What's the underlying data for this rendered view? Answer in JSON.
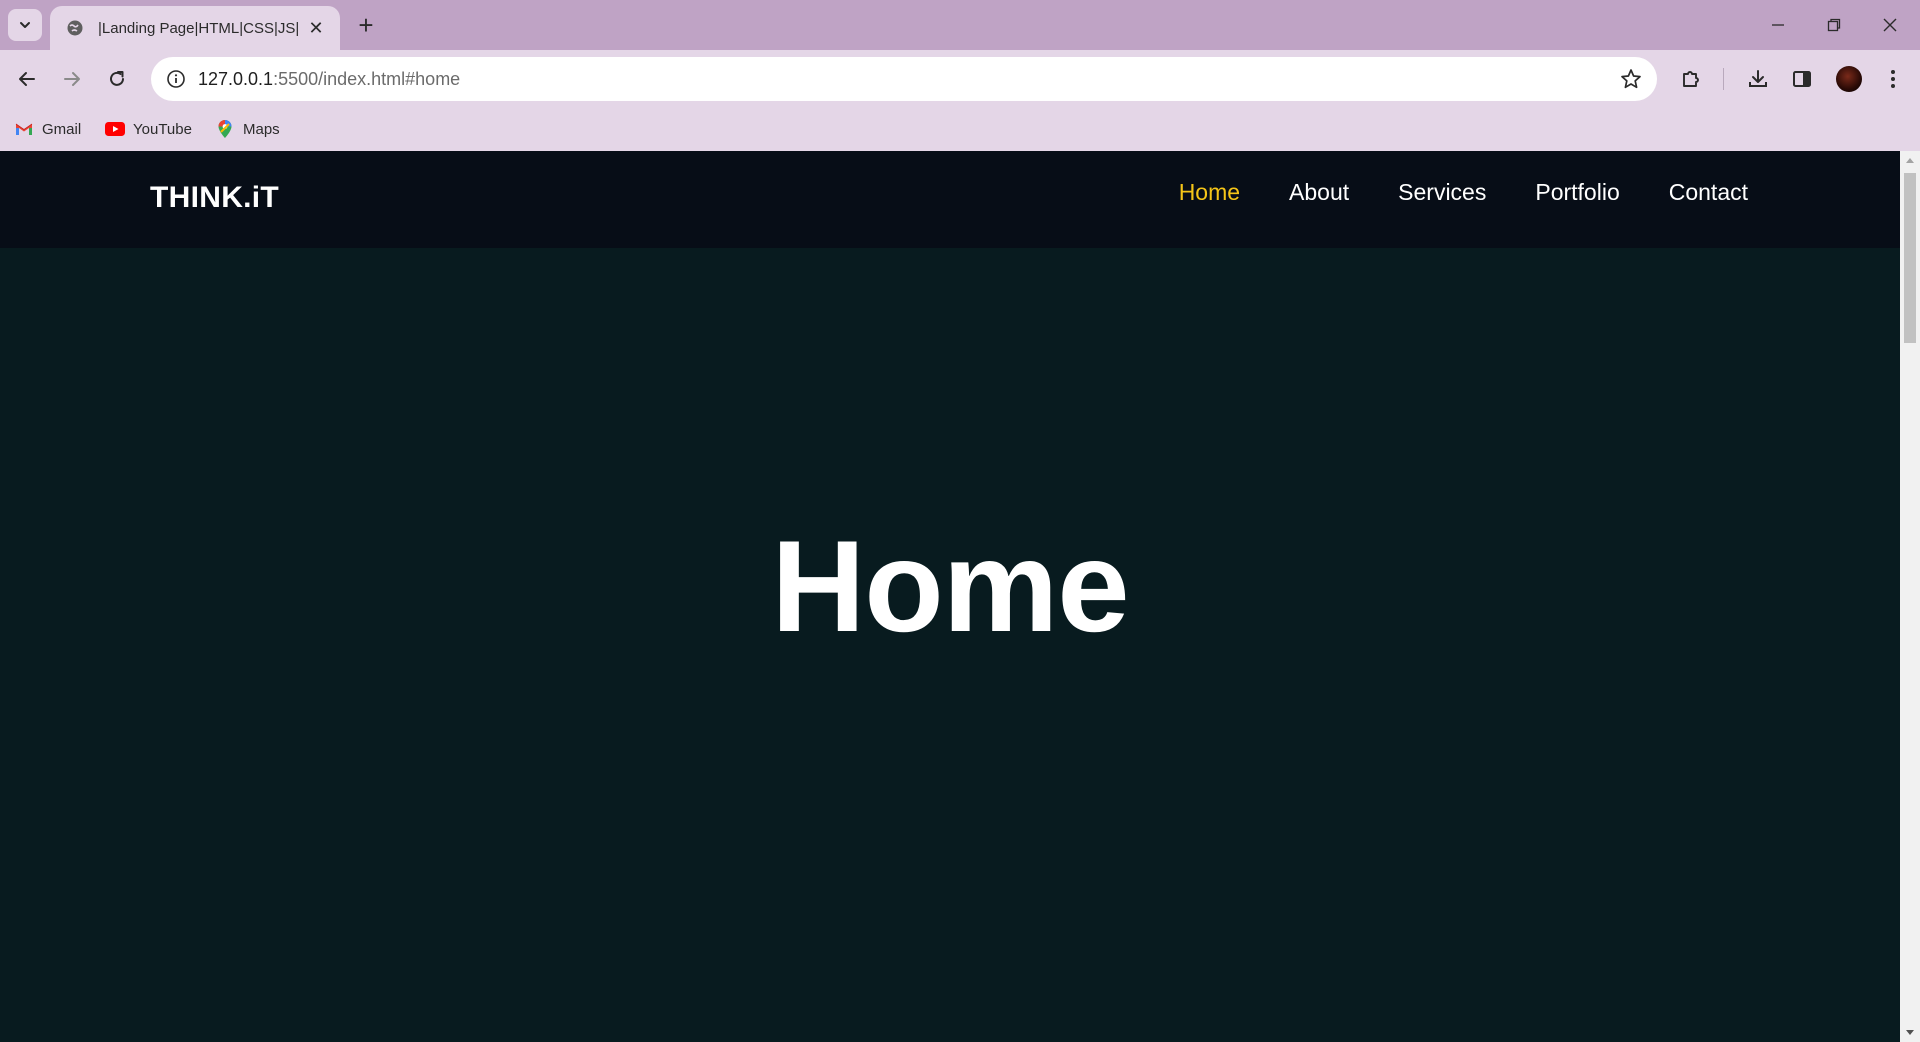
{
  "browser": {
    "tab": {
      "title": "|Landing Page|HTML|CSS|JS|",
      "close_glyph": "✕"
    },
    "new_tab_glyph": "+",
    "address": {
      "host": "127.0.0.1",
      "rest": ":5500/index.html#home"
    },
    "bookmarks": [
      {
        "label": "Gmail",
        "icon": "gmail-icon"
      },
      {
        "label": "YouTube",
        "icon": "youtube-icon"
      },
      {
        "label": "Maps",
        "icon": "maps-icon"
      }
    ]
  },
  "site": {
    "logo": "THINK.iT",
    "nav": [
      {
        "label": "Home",
        "active": true
      },
      {
        "label": "About",
        "active": false
      },
      {
        "label": "Services",
        "active": false
      },
      {
        "label": "Portfolio",
        "active": false
      },
      {
        "label": "Contact",
        "active": false
      }
    ],
    "hero_title": "Home"
  },
  "colors": {
    "tabstrip": "#bfa3c5",
    "toolbar": "#e4d6e7",
    "header": "#070d17",
    "page_bg": "#081b1f",
    "nav_active": "#f5c518"
  }
}
